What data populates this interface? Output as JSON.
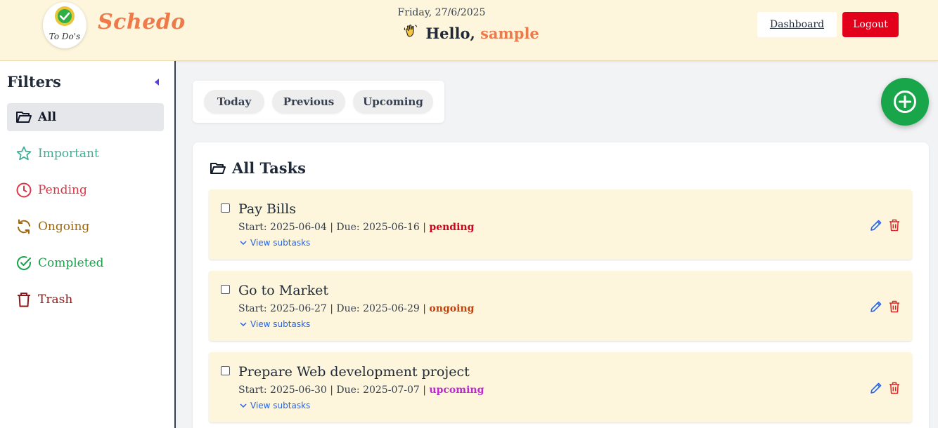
{
  "header": {
    "brand": "Schedo",
    "logo_text": "To Do's",
    "date": "Friday, 27/6/2025",
    "greeting": "Hello,",
    "username": "sample",
    "dashboard_label": "Dashboard",
    "logout_label": "Logout"
  },
  "sidebar": {
    "title": "Filters",
    "items": [
      {
        "label": "All",
        "icon": "folder-open-icon",
        "color": "#111827",
        "active": true
      },
      {
        "label": "Important",
        "icon": "star-icon",
        "color": "#3fae95"
      },
      {
        "label": "Pending",
        "icon": "clock-icon",
        "color": "#dc3545"
      },
      {
        "label": "Ongoing",
        "icon": "refresh-icon",
        "color": "#a0670f"
      },
      {
        "label": "Completed",
        "icon": "check-circle-icon",
        "color": "#16a34a"
      },
      {
        "label": "Trash",
        "icon": "trash-icon",
        "color": "#8b1a1a"
      }
    ]
  },
  "tabs": [
    {
      "label": "Today"
    },
    {
      "label": "Previous"
    },
    {
      "label": "Upcoming"
    }
  ],
  "tasks_section": {
    "title": "All Tasks",
    "tasks": [
      {
        "title": "Pay Bills",
        "meta": "Start: 2025-06-04 | Due: 2025-06-16 |",
        "status": "pending",
        "status_color": "#d0021b",
        "subtasks_label": "View subtasks"
      },
      {
        "title": "Go to Market",
        "meta": "Start: 2025-06-27 | Due: 2025-06-29 |",
        "status": "ongoing",
        "status_color": "#c2410c",
        "subtasks_label": "View subtasks"
      },
      {
        "title": "Prepare Web development project",
        "meta": "Start: 2025-06-30 | Due: 2025-07-07 |",
        "status": "upcoming",
        "status_color": "#c026d3",
        "subtasks_label": "View subtasks"
      }
    ]
  },
  "colors": {
    "accent": "#ee7a4a",
    "header_bg": "#fef6dc",
    "logout": "#e3001b",
    "fab": "#19a64b",
    "link": "#2563eb",
    "task_bg": "#fdf6dc"
  }
}
